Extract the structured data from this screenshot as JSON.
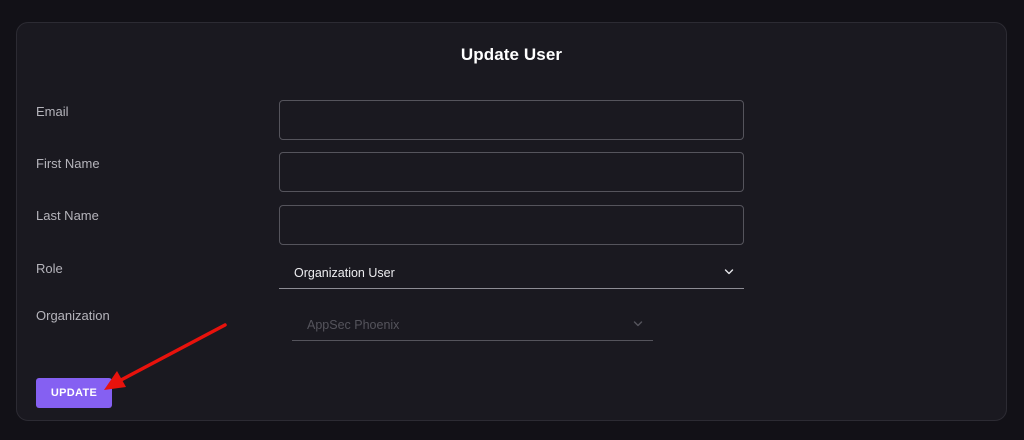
{
  "form": {
    "title": "Update User",
    "fields": [
      {
        "label": "Email",
        "value": "",
        "placeholder": ""
      },
      {
        "label": "First Name",
        "value": "",
        "placeholder": ""
      },
      {
        "label": "Last Name",
        "value": "",
        "placeholder": ""
      },
      {
        "label": "Role",
        "value": "Organization User"
      },
      {
        "label": "Organization",
        "value": "AppSec Phoenix",
        "disabled": true
      }
    ],
    "submit_label": "UPDATE"
  },
  "icons": {
    "dropdown": "chevron-down-icon",
    "annotation": "arrow-annotation-icon"
  },
  "colors": {
    "background": "#121117",
    "card": "#1a1920",
    "accent": "#8560f2",
    "annotation_arrow": "#e8120c"
  }
}
